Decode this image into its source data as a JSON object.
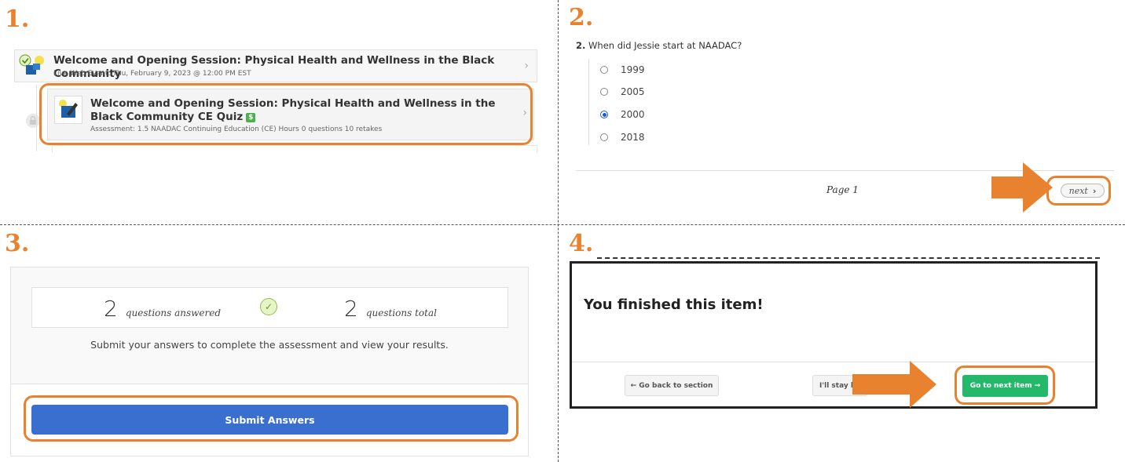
{
  "steps": {
    "s1": "1.",
    "s2": "2.",
    "s3": "3.",
    "s4": "4."
  },
  "panel1": {
    "row1_title": "Welcome and Opening Session: Physical Health and Wellness in the Black Community",
    "row1_sub": "Live Web Event:  Thu, February 9, 2023 @ 12:00 PM EST",
    "row2_title": "Welcome and Opening Session: Physical Health and Wellness in the Black Community CE Quiz",
    "row2_badge": "$",
    "row2_sub": "Assessment: 1.5 NAADAC Continuing Education (CE) Hours  0 questions  10 retakes",
    "chevron": "›"
  },
  "panel2": {
    "question_number": "2.",
    "question": "When did Jessie start at NAADAC?",
    "options": [
      {
        "label": "1999",
        "selected": false
      },
      {
        "label": "2005",
        "selected": false
      },
      {
        "label": "2000",
        "selected": true
      },
      {
        "label": "2018",
        "selected": false
      }
    ],
    "page_label": "Page 1",
    "next_label": "next",
    "next_chevron": "›"
  },
  "panel3": {
    "answered_num": "2",
    "answered_label": "questions answered",
    "check": "✓",
    "total_num": "2",
    "total_label": "questions total",
    "message": "Submit your answers to complete the assessment and view your results.",
    "submit_label": "Submit Answers"
  },
  "panel4": {
    "heading": "You finished this item!",
    "back_label": "← Go back to section",
    "stay_label": "I'll stay h",
    "next_label": "Go to next item →"
  },
  "colors": {
    "accent_orange": "#e8822f",
    "submit_blue": "#3b6fcf",
    "green": "#23b86a",
    "radio_blue": "#1a5bd6"
  }
}
